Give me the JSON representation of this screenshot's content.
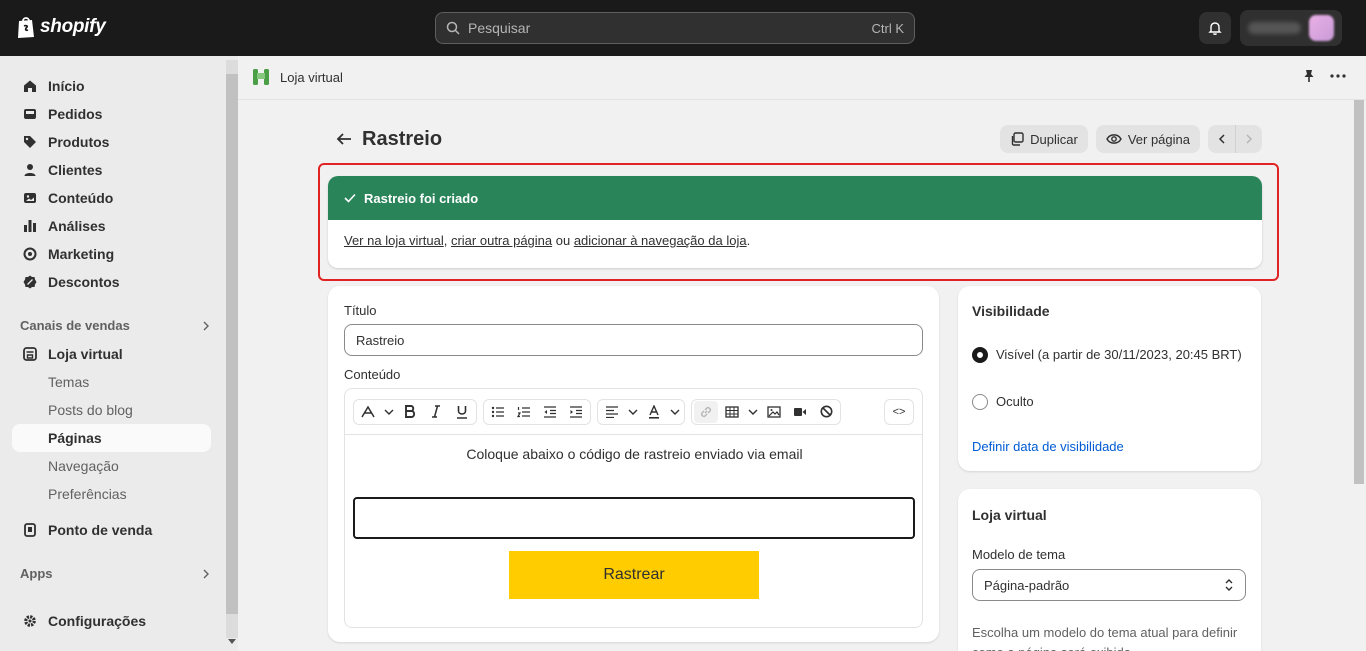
{
  "topbar": {
    "logo_text": "shopify",
    "search_placeholder": "Pesquisar",
    "search_shortcut": "Ctrl K"
  },
  "sidebar": {
    "items": [
      {
        "label": "Início",
        "icon": "home-icon"
      },
      {
        "label": "Pedidos",
        "icon": "inbox-icon"
      },
      {
        "label": "Produtos",
        "icon": "tag-icon"
      },
      {
        "label": "Clientes",
        "icon": "person-icon"
      },
      {
        "label": "Conteúdo",
        "icon": "image-icon"
      },
      {
        "label": "Análises",
        "icon": "bar-chart-icon"
      },
      {
        "label": "Marketing",
        "icon": "target-icon"
      },
      {
        "label": "Descontos",
        "icon": "discount-icon"
      }
    ],
    "sales_channels_heading": "Canais de vendas",
    "online_store": {
      "label": "Loja virtual",
      "icon": "store-icon"
    },
    "online_store_sub": [
      "Temas",
      "Posts do blog",
      "Páginas",
      "Navegação",
      "Preferências"
    ],
    "pos": {
      "label": "Ponto de venda",
      "icon": "pos-icon"
    },
    "apps_heading": "Apps",
    "settings": {
      "label": "Configurações",
      "icon": "gear-icon"
    }
  },
  "context_bar": {
    "title": "Loja virtual"
  },
  "page": {
    "title": "Rastreio",
    "duplicate_label": "Duplicar",
    "view_page_label": "Ver página"
  },
  "banner": {
    "title": "Rastreio foi criado",
    "link_view": "Ver na loja virtual",
    "sep1": ", ",
    "link_create": "criar outra página",
    "sep2": " ou ",
    "link_nav": "adicionar à navegação da loja",
    "end": "."
  },
  "form": {
    "title_label": "Título",
    "title_value": "Rastreio",
    "content_label": "Conteúdo",
    "toolbar_code": "<>",
    "editor_text": "Coloque abaixo o código de rastreio enviado via email",
    "editor_button": "Rastrear"
  },
  "visibility": {
    "title": "Visibilidade",
    "visible_label": "Visível (a partir de 30/11/2023, 20:45 BRT)",
    "hidden_label": "Oculto",
    "set_date_link": "Definir data de visibilidade",
    "selected": "visible"
  },
  "online_store_card": {
    "title": "Loja virtual",
    "template_label": "Modelo de tema",
    "template_value": "Página-padrão",
    "help_text": "Escolha um modelo do tema atual para definir como a página será exibida."
  },
  "colors": {
    "banner_success": "#29845a",
    "link": "#005bd3",
    "highlight": "#e02424",
    "editor_button": "#ffcc00"
  }
}
